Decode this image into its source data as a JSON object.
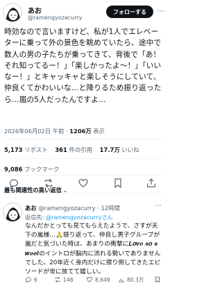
{
  "author": {
    "name": "あお",
    "handle": "@ramengyozacurry",
    "follow_label": "フォローする"
  },
  "tweet": {
    "text": "時効なので言いますけど、私が1人でエレベーターに乗って外の景色を眺めていたら、途中で数人の男の子たちが乗ってきて、背後で「あ！それ知ってるー！」「楽しかったよ〜！」「いいなー！」とキャッキャと楽しそうにしていて、仲良くてかわいいな…と降りるため振り返ったら…嵐の5人だったんですよ…",
    "date": "2026年06月02日 午前",
    "dot": "·",
    "views": "1206万",
    "views_label": "表示"
  },
  "stats": {
    "reposts": "5,173",
    "reposts_label": "リポスト",
    "quotes": "361",
    "quotes_label": "件の引用",
    "likes": "17.7万",
    "likes_label": "いいね",
    "bookmarks": "9,086",
    "bookmarks_label": "ブックマーク"
  },
  "actions": {
    "icons": [
      "reply-icon",
      "repost-icon",
      "like-icon",
      "bookmark-icon",
      "share-icon"
    ]
  },
  "section": {
    "label": "最も関連性の高い返信",
    "chevron": "⌄"
  },
  "reply": {
    "name": "あお",
    "handle": "@ramengyozacurry",
    "time": "· 12時間",
    "more": "···",
    "to_prefix": "返信先:",
    "to_link": "@ramengyozacurryさん",
    "text": "なんだかとっても見てもらえたようで、さすが天下の嵐様…🙏振り返って、仲良し男子グループが嵐だと気づいた時は、あまりの衝撃に𝑳𝒐𝒗𝒆 𝒔𝒐 𝒔𝒘𝒆𝒆𝒕のイントロが脳内に流れる勢いでありませんでした。20年近く身内だけに擦り倒してきたエピソードが世に放てて嬉しい。",
    "replies": "6",
    "reposts": "148",
    "likes": "8,649",
    "views": "80.3万"
  },
  "colors": {
    "text": "#0f1419",
    "secondary": "#536471",
    "link": "#1d9bf0",
    "button_bg": "#0f1419",
    "divider": "#eff3f4"
  }
}
